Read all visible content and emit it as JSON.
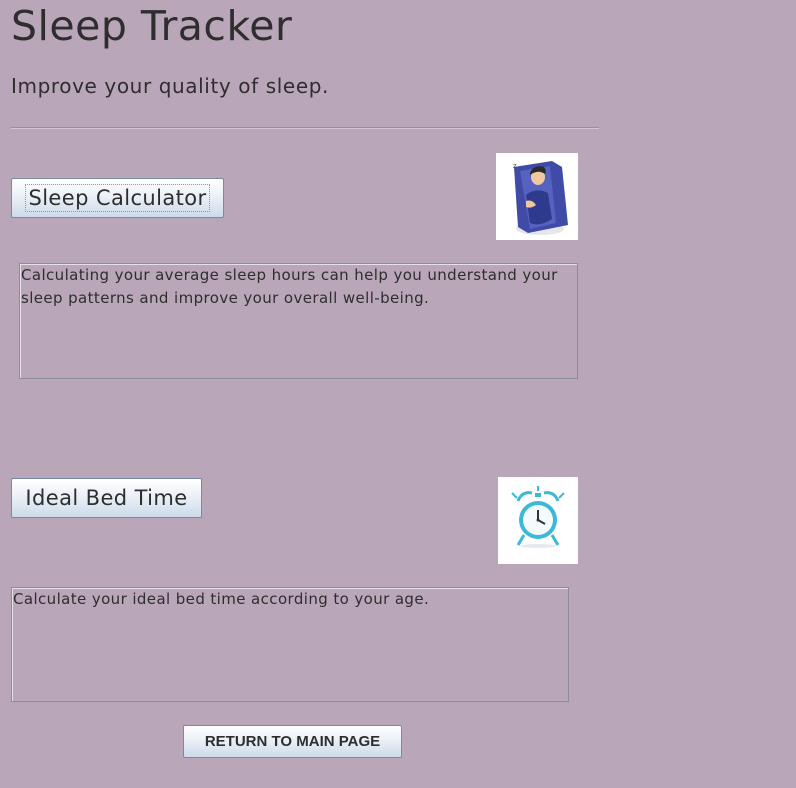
{
  "header": {
    "title": "Sleep Tracker",
    "subtitle": "Improve your quality of sleep."
  },
  "sleep_calculator": {
    "button_label": "Sleep Calculator",
    "image_icon": "sleeping-person-icon",
    "description": "Calculating your average sleep hours can help you understand your\nsleep patterns and improve your overall well-being."
  },
  "ideal_bed_time": {
    "button_label": "Ideal Bed Time",
    "image_icon": "alarm-clock-icon",
    "description": "Calculate your ideal bed time according to your age."
  },
  "footer": {
    "return_label": "RETURN TO MAIN PAGE"
  },
  "colors": {
    "background": "#baa6b9",
    "text": "#2e2e2e",
    "clock": "#3db8d8",
    "pillow": "#3f4ba6"
  }
}
